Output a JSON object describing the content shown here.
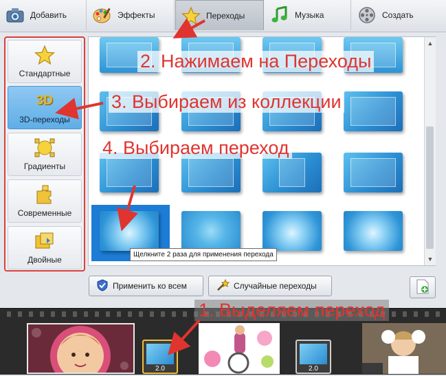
{
  "tabs": [
    {
      "label": "Добавить",
      "icon": "camera-icon"
    },
    {
      "label": "Эффекты",
      "icon": "palette-icon"
    },
    {
      "label": "Переходы",
      "icon": "star-icon",
      "active": true
    },
    {
      "label": "Музыка",
      "icon": "music-note-icon"
    },
    {
      "label": "Создать",
      "icon": "film-reel-icon"
    }
  ],
  "sidebar": {
    "items": [
      {
        "label": "Стандартные",
        "icon": "star-icon"
      },
      {
        "label": "3D-переходы",
        "icon": "3d-icon",
        "icon_text": "3D",
        "active": true
      },
      {
        "label": "Градиенты",
        "icon": "gradient-circle-icon"
      },
      {
        "label": "Современные",
        "icon": "puzzle-icon"
      },
      {
        "label": "Двойные",
        "icon": "double-transition-icon"
      }
    ]
  },
  "gallery": {
    "tooltip": "Щелкните 2 раза для применения перехода",
    "selected_index": 12
  },
  "buttons": {
    "apply_all": "Применить ко всем",
    "random": "Случайные переходы"
  },
  "timeline": {
    "transition_duration_1": "2.0",
    "transition_duration_2": "2.0"
  },
  "annotations": {
    "step1": "1. Выделяем переход",
    "step2": "2. Нажимаем на Переходы",
    "step3": "3. Выбираем из коллекции",
    "step4": "4. Выбираем переход"
  },
  "colors": {
    "accent_red": "#e0342f",
    "active_blue": "#5faee6",
    "selection_blue": "#1c7cd6"
  }
}
